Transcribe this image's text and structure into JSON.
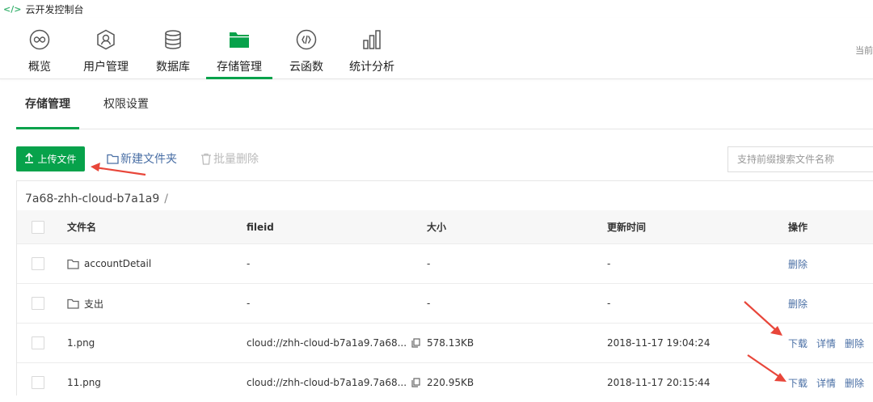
{
  "app": {
    "title": "云开发控制台"
  },
  "nav": {
    "items": [
      {
        "label": "概览",
        "icon": "infinity-icon"
      },
      {
        "label": "用户管理",
        "icon": "user-icon"
      },
      {
        "label": "数据库",
        "icon": "database-icon"
      },
      {
        "label": "存储管理",
        "icon": "folder-icon",
        "active": true
      },
      {
        "label": "云函数",
        "icon": "function-icon"
      },
      {
        "label": "统计分析",
        "icon": "bar-chart-icon"
      }
    ],
    "right_text": "当前"
  },
  "subtabs": [
    {
      "label": "存储管理",
      "active": true
    },
    {
      "label": "权限设置"
    }
  ],
  "toolbar": {
    "upload_label": "上传文件",
    "new_folder_label": "新建文件夹",
    "batch_delete_label": "批量删除",
    "search_placeholder": "支持前缀搜索文件名称"
  },
  "breadcrumb": {
    "path": "7a68-zhh-cloud-b7a1a9",
    "separator": "/"
  },
  "table": {
    "headers": {
      "name": "文件名",
      "fileid": "fileid",
      "size": "大小",
      "updated": "更新时间",
      "actions": "操作"
    },
    "rows": [
      {
        "name": "accountDetail",
        "fileid": "-",
        "size": "-",
        "updated": "-",
        "actions": [
          "删除"
        ],
        "is_folder": true
      },
      {
        "name": "支出",
        "fileid": "-",
        "size": "-",
        "updated": "-",
        "actions": [
          "删除"
        ],
        "is_folder": true
      },
      {
        "name": "1.png",
        "fileid": "cloud://zhh-cloud-b7a1a9.7a68...",
        "size": "578.13KB",
        "updated": "2018-11-17 19:04:24",
        "actions": [
          "下载",
          "详情",
          "删除"
        ],
        "is_folder": false
      },
      {
        "name": "11.png",
        "fileid": "cloud://zhh-cloud-b7a1a9.7a68...",
        "size": "220.95KB",
        "updated": "2018-11-17 20:15:44",
        "actions": [
          "下载",
          "详情",
          "删除"
        ],
        "is_folder": false
      }
    ]
  },
  "colors": {
    "accent": "#07a24b",
    "link": "#4a6fa5",
    "annotation": "#e8463a"
  }
}
